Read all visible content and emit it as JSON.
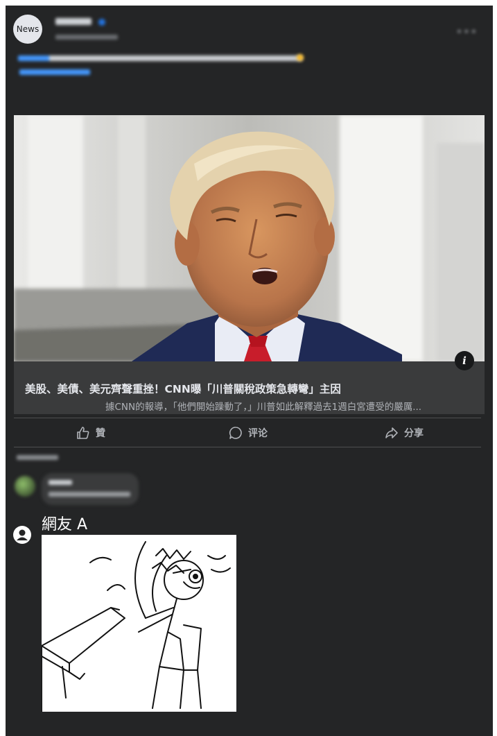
{
  "post": {
    "avatar_text": "News",
    "page_name": "",
    "time": "",
    "text": "",
    "link_text": ""
  },
  "article": {
    "title": "美股、美債、美元齊聲重挫！CNN曝「川普關稅政策急轉彎」主因",
    "description": "據CNN的報導，「他們開始躁動了，」川普如此解釋過去1週白宮遭受的嚴厲..."
  },
  "actions": {
    "like_label": "贊",
    "comment_label": "评论",
    "share_label": "分享"
  },
  "comments": {
    "sort_label": "",
    "first": {
      "name": "",
      "text": ""
    },
    "reply": {
      "name": "網友 A"
    }
  },
  "icons": {
    "info": "info-icon",
    "like": "thumbs-up-icon",
    "comment": "comment-bubble-icon",
    "share": "share-arrow-icon",
    "user": "user-avatar-icon"
  },
  "colors": {
    "card_background": "#242526",
    "link_box_background": "#3a3b3c",
    "accent_blue": "#4599ff"
  }
}
